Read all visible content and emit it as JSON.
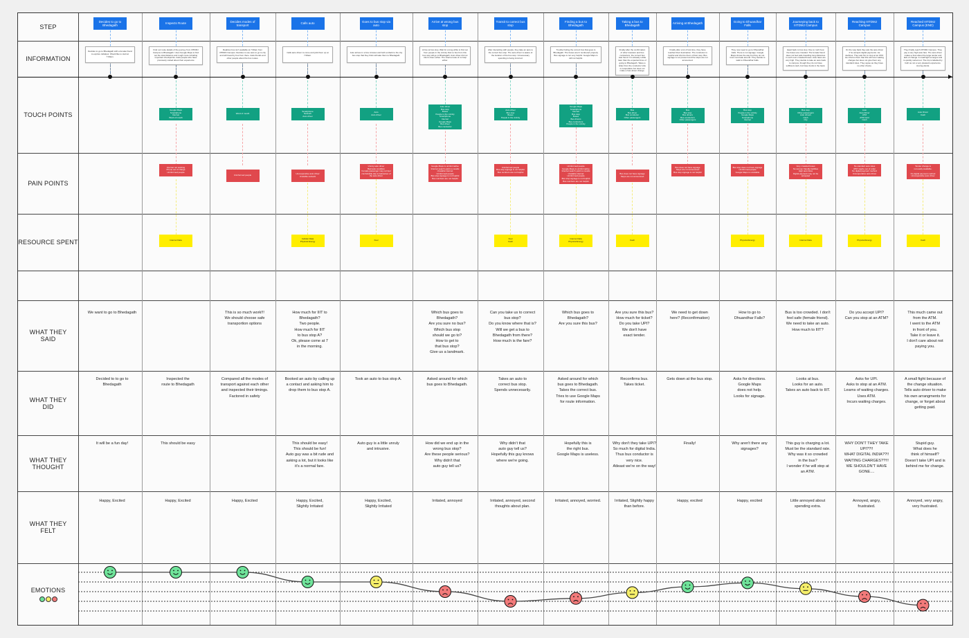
{
  "row_labels": {
    "step": "STEP",
    "information": "INFORMATION",
    "touch_points": "TOUCH POINTS",
    "pain_points": "PAIN POINTS",
    "resource_spent": "RESOURCE SPENT",
    "blank": "",
    "what_they_said": "WHAT THEY\nSAID",
    "what_they_did": "WHAT THEY\nDID",
    "what_they_thought": "WHAT THEY\nTHOUGHT",
    "what_they_felt": "WHAT THEY\nFELT",
    "emotions": "EMOTIONS"
  },
  "colors": {
    "step": "#1a73e8",
    "touch_point": "#12a182",
    "pain_point": "#e0484d",
    "resource": "#ffee00",
    "happy": "#6fe39a",
    "neutral": "#f5ee6a",
    "sad": "#f27a7a"
  },
  "emotion_legend": [
    "happy",
    "neutral",
    "sad"
  ],
  "columns": [
    {
      "step": "Decides to go to Bhedagath",
      "information": "Decides to go to Bhedagath with a female friend to explore Jabalpur. Would like to start at 7:00am.",
      "touch_points": "",
      "pain_points": "",
      "resource": "",
      "said": "We want to go to Bhedagath",
      "did": "Decided to to go to\nBhedagath",
      "thought": "It will be a fun day!",
      "felt": "Happy, Excited",
      "emotion": "happy",
      "emotion_level": 5
    },
    {
      "step": "Inspects Route",
      "information": "Find out route details of the journey from IIITDMJ Campus to Bhedagath. Uses Google Maps to find out the total distance and rough route including important checkpoints. Asks people who have previously visited about their experience",
      "touch_points": "Google Maps\nSmartphone\nInternet\nWord of mouth",
      "pain_points": "Internet not working\nPhone out of charge\nUninformed people",
      "resource": "Internet Data",
      "said": "",
      "did": "Inspected the\nroute to Bhedagath",
      "thought": "This should be easy",
      "felt": "Happy, Excited",
      "emotion": "happy",
      "emotion_level": 5
    },
    {
      "step": "Decides modes of transport",
      "information": "Realizes bus isn't available at 7:00am from IIITDMJ Campus. Decides to use auto to go to city and will travel by bus from there. Asks friends and other people about the bus routes.",
      "touch_points": "Word of mouth",
      "pain_points": "Uninformed people",
      "resource": "",
      "said": "This is so much work!!!\nWe should choose safe\ntransportion options",
      "did": "Compared all the modes of\ntransport against each other\nand inspected their timings.\nFactored in safety",
      "thought": "",
      "felt": "Happy, Excited",
      "emotion": "happy",
      "emotion_level": 5
    },
    {
      "step": "Calls auto",
      "information": "Calls auto driver to come and pick them up at 7:00am.",
      "touch_points": "Smartphone\nNetwork\nAuto driver",
      "pain_points": "Uncooperative auto driver\nUnstable network",
      "resource": "Cellular Data\nPhysical Energy",
      "said": "How much for IIIT to\nBhedagath?\nTwo people.\nHow much for IIIT\nto bus stop A?\nOk, please come at 7\nin the morning.",
      "did": "Booked an auto by calling up\na contact and asking him to\ndrop them to bus stop A.",
      "thought": "This should be easy!\nThis should be fun!\nAuto guy was a bit rude and\nasking a lot, but it looks like\nit's a normal fare.",
      "felt": "Happy, Excited,\nSlightly Irritated",
      "emotion": "happy",
      "emotion_level": 4
    },
    {
      "step": "Goes to bus stop via auto",
      "information": "Auto arrives in a few minutes and both embark to the city bus stop that they think will take them to Bhedagath.",
      "touch_points": "Auto\nAuto driver",
      "pain_points": "Unruly auto driver\nBad auto condition\nFemale passenger may not feel comfortable due to behaviour of the auto driver",
      "resource": "Fuel",
      "said": "",
      "did": "Took an auto to bus stop A.",
      "thought": "Auto guy is a little unruly\nand intrusive.",
      "felt": "Happy, Excited,\nSlightly Irritated",
      "emotion": "neutral",
      "emotion_level": 4
    },
    {
      "step": "Arrive at wrong bus stop",
      "information": "Arrive at bus stop. Wait for a long while to find out from people in the vicinity that no bus from this bus stop will go to Bhedagath. Auto driver did not inform them either. The internet was of no help either.",
      "touch_points": "Auto driver\nBus stop\nBuses\nPeople in the vicinity\nSmartphone\nInternet\nGoogle Maps\nBus driver\nBus conductor",
      "pain_points": "Google Maps is uninformative\nInternet search yield no results\nUnstable internet\nUninformed people\nBus stop signage is not helpful\nBus numbers are not helpful",
      "resource": "",
      "said": "Which bus goes to\nBhedagath?\nAre you sure no bus?\nWhich bus stop\nshould we go to?\nHow to get to\nthat bus stop?\nGive us a landmark.",
      "did": "Asked around for which\nbus goes to Bhedagath.",
      "thought": "How did we end up in the\nwrong bus stop?\nAre these people serious?\nWhy didn't that\nauto guy tell us?",
      "felt": "Irritated, annoyed",
      "emotion": "sad",
      "emotion_level": 3
    },
    {
      "step": "Transit to correct bus stop",
      "information": "After interacting with people, they take an auto to the correct bus stop. The auto driver is aware of the location of the bus stop. Unnecessary spending is being incurred.",
      "touch_points": "Auto driver\nBus stop\nBuses\nPeople in the vicinity",
      "pain_points": "Uninformed people\nBus stop signage is not helpful\nBus numbers are not helpful",
      "resource": "Fuel\nCash",
      "said": "Can you take us to correct\nbus stop?\nDo you know where that is?\nWill we get a bus to\nBhedagath from there?\nHow much is the fare?",
      "did": "Takes an auto to\ncorrect bus stop.\nSpends unnecesarily.",
      "thought": "Why didn't that\nauto guy tell us?\nHopefully this guy knows\nwhere we're going.",
      "felt": "Irritated, annoyed, second\nthoughts about plan.",
      "emotion": "sad",
      "emotion_level": 2
    },
    {
      "step": "Finding a bus to Bhedagath",
      "information": "Trouble finding the correct bus that goes to Bhedagath. The buses aren't numbered properly. Bus signage is not very helpful. Google Maps is still not helpful.",
      "touch_points": "Google Maps\nSmartphone\nInternet\nBus stop\nBuses\nBus drivers\nBus conductors\nPeople in the vicinity",
      "pain_points": "Uninformed people\nGoogle Maps is uninformative\nInternet search yield no results\nUnstable internet\nUninformed people\nBus stop signage is not helpful\nBus numbers are not helpful",
      "resource": "Internet Data\nPhysical Energy",
      "said": "Which bus goes to\nBhedagath?\nAre you sure this bus?",
      "did": "Asked around for which\nbus goes to Bhedagath.\nTakes the correct bus.\nTries to use Google Maps\nfor route information.",
      "thought": "Hopefully this is\nthe right bus.\nGoogle Maps is useless.",
      "felt": "Irritated, annoyed, worried.",
      "emotion": "sad",
      "emotion_level": 2.3
    },
    {
      "step": "Taking a bus to Bhedagath",
      "information": "Finally after the confirmation of other travelers and bus conductors, the correct bus was found. It is already a little later than the expected time of going to Bhedagath. Takes a ticket from the conductor who is cooperative but does not make a fuss about change.",
      "touch_points": "Bus\nBus driver\nBus conductor\nOther passengers",
      "pain_points": "Bus does not have signage\nStops are not announced",
      "resource": "Cash",
      "said": "Are you sure this bus?\nHow much for ticket?\nDo you take UPI?\nWe don't have\nexact tender.",
      "did": "Reconfirms bus.\nTakes ticket.",
      "thought": "Why don't they take UPI?\nSo much for digital India.\nThus bus conductor is\nvery nice.\nAtleast we're on the way!",
      "felt": "Irritated, Slightly happy\nthan before.",
      "emotion": "neutral",
      "emotion_level": 2.9
    },
    {
      "step": "Arriving at Bhedagath",
      "information": "Finally after a lot of lost time, they have reached their destination. The conductor is helpful and informs them of their stop. Bus signage is not present and the stops are not announced.",
      "touch_points": "Bus\nBus stop\nBus drivers\nBus conductors\nOther passengers",
      "pain_points": "Bus does not have signage\nStops are not announced\nBus stop signage is not helpful",
      "resource": "",
      "said": "We need to get down\nhere? (Reconfirmation)",
      "did": "Gets down at the bus stop.",
      "thought": "Finally!",
      "felt": "Happy, excited",
      "emotion": "happy",
      "emotion_level": 3.5
    },
    {
      "step": "Going to Dhuandhar Falls",
      "information": "They now need to go to Dhuandhar Falls. There is not signage. Google Maps shows the way but they do not trust it and ask around. They decide to walk to Dhuandhar Falls.",
      "touch_points": "Bus stop\nPeople in the vicinity\nGoogle Maps\nSmartphone\nInternet",
      "pain_points": "Bus stop does not have signage\nUninformed people\nGoogle Maps is unreliable",
      "resource": "Physical Energy",
      "said": "How to go to\nDhuandhar Falls?",
      "did": "Asks for directions.\nGoogle Maps\ndoes not help.\nLooks for signage.",
      "thought": "Why aren't there any\nsignages?",
      "felt": "Happy, excited",
      "emotion": "happy",
      "emotion_level": 3.9
    },
    {
      "step": "Journeying back to IIITDMJ Campus",
      "information": "Head back to bus stop. Due to rush hour, the buses are crowded. The female friend does not feel safe travelling long distances in such over-crowded buses. Auto fares are very high. They decide to take an auto back to campus, though they do not have sufficient cash, but have funds in the bank.",
      "touch_points": "Bus stop\nOther passengers\nAuto drivers\nCash\nCity",
      "pain_points": "Very crowded buses\nNo women friendly facilities\nHigh auto fares\nDigital payment may not be accepted",
      "resource": "Internet Data",
      "said": "Bus is too crowded. I don't\nfeel safe (female friend).\nWe need to take an auto.\nHow much to IIIT?",
      "did": "Looks at bus.\nLooks for an auto.\nTakes an auto back to IIIT.",
      "thought": "This guy is charging a lot.\nMust be the standard rate.\nWhy was it so crowded\nin the bus?\nI wonder if he will stop at\nan ATM.",
      "felt": "Little annoyed about\nspending extra.",
      "emotion": "neutral",
      "emotion_level": 3.3
    },
    {
      "step": "Reaching IIITDMJ Campus",
      "information": "On the way back they ask the auto driver if he accepts digital payments. He declines. They ask him to stop at an ATM. He informs them that this will incur waiting charges but does not give them any standard rates. They agree as they have no other choice.",
      "touch_points": "Auto\nAuto Driver\nATM\nATM Card\nCash",
      "pain_points": "No standard auto rates\nATM maybe out of order\nNo digital payment method\nUncooperative auto driver",
      "resource": "Physical Energy",
      "said": "Do you accept UPI?\nCan you stop at an ATM?",
      "did": "Asks for UPI.\nAsks to stop at an ATM.\nLearns of waiting charges.\nUses ATM.\nIncurs waiting charges.",
      "thought": "WHY DON'T THEY TAKE\nUPI??!!\nWHAT DIGITAL INDIA??!!\nWAITING CHARGES??!!!\nWE SHOULDN'T HAVE\nGONE....",
      "felt": "Annoyed, angry,\nfrustrated.",
      "emotion": "sad",
      "emotion_level": 2.5
    },
    {
      "step": "Reached IIITDMJ Campus (END)",
      "information": "They finally reach IIITDMJ Campus. They pay a very high auto fare. The auto driver makes a fuss about the large tender and lack of change. A small fight emerges and is quickly sorted out. The trip is labelled by both as not a very pleasant experience. Journey Ends.",
      "touch_points": "Auto Driver\nCash",
      "pain_points": "Tender change is\nnot easily available.\n\nNo digital payment method\nUncooperative auto driver",
      "resource": "Cash",
      "said": "This much came out\nfrom the ATM.\nI went to the ATM\nin front of you.\nTake it or leave it.\nI don't care about not\npaying you.",
      "did": "A small fight because of\nthe change situation.\nTells auto driver to make\nhis own arrangments for\nchange, or forget about\ngetting paid.",
      "thought": "Stupid guy.\nWhat does he\nthink of himself?\nDoesn't take UPI and is\nbehind me for change.",
      "felt": "Annoyed, very angry,\nvery frustrated.",
      "emotion": "sad",
      "emotion_level": 1.6
    }
  ]
}
